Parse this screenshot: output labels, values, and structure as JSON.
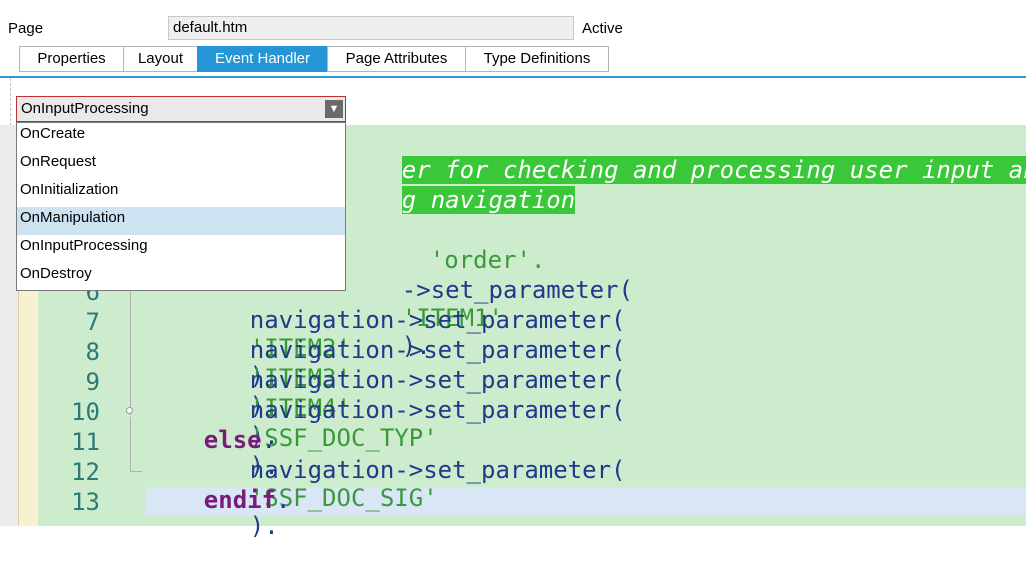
{
  "header": {
    "page_label": "Page",
    "page_value": "default.htm",
    "status": "Active"
  },
  "tabs": [
    {
      "label": "Properties"
    },
    {
      "label": "Layout"
    },
    {
      "label": "Event Handler",
      "active": true
    },
    {
      "label": "Page Attributes"
    },
    {
      "label": "Type Definitions"
    }
  ],
  "event_select": {
    "selected": "OnInputProcessing",
    "options": [
      "OnCreate",
      "OnRequest",
      "OnInitialization",
      "OnManipulation",
      "OnInputProcessing",
      "OnDestroy"
    ],
    "highlighted": "OnManipulation"
  },
  "editor": {
    "line_numbers": [
      "6",
      "7",
      "8",
      "9",
      "10",
      "11",
      "12",
      "13"
    ],
    "comment_1": "er for checking and processing user input and",
    "comment_2": "g navigation",
    "string_order": "'order'.",
    "method_call": "->set_parameter(",
    "navigation": "navigation",
    "items": [
      "'ITEM1'",
      "'ITEM2'",
      "'ITEM3'",
      "'ITEM4'",
      "'SSF_DOC_TYP'",
      "'SSF_DOC_SIG'"
    ],
    "close": ").",
    "kw_else": "else",
    "kw_endif": "endif",
    "dot": "."
  }
}
